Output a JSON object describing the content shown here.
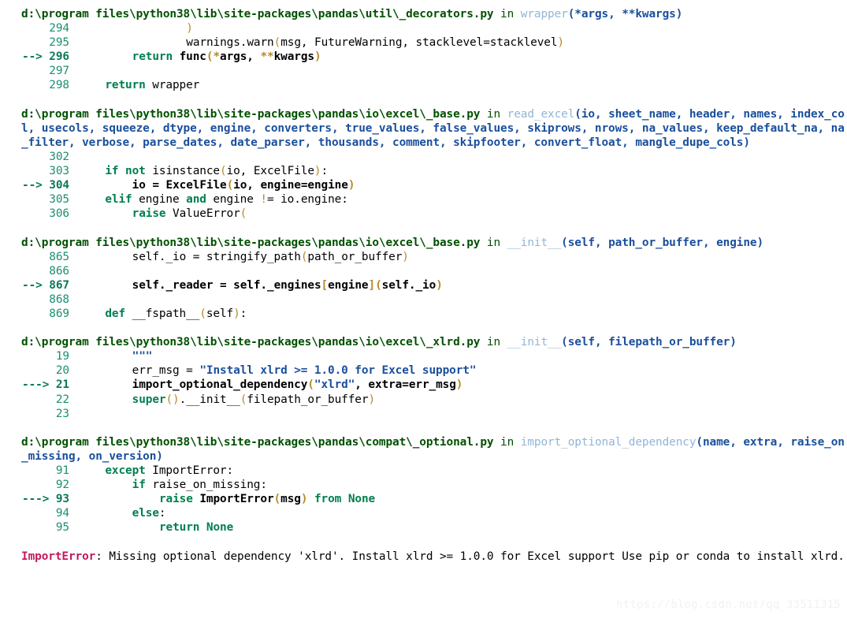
{
  "colors": {
    "background": "#ffffff",
    "filepath": "#005000",
    "function_name": "#92b5d6",
    "signature": "#1a4f9c",
    "line_number": "#1a8f72",
    "keyword": "#007f4f",
    "punctuation": "#b58b2a",
    "string": "#1a4f9c",
    "error_type": "#c2185b",
    "code": "#000000",
    "watermark": "#f2f2f2"
  },
  "traceback": {
    "frames": [
      {
        "id": "frame-decorators",
        "path": "d:\\program files\\python38\\lib\\site-packages\\pandas\\util\\_decorators.py",
        "in_kw": " in ",
        "func": "wrapper",
        "signature": "(*args, **kwargs)",
        "lines": [
          {
            "num": "294",
            "arrow": "",
            "current": false,
            "code": "                )"
          },
          {
            "num": "295",
            "arrow": "",
            "current": false,
            "code": "                warnings.warn(msg, FutureWarning, stacklevel=stacklevel)"
          },
          {
            "num": "296",
            "arrow": "-->",
            "current": true,
            "code": "        return func(*args, **kwargs)"
          },
          {
            "num": "297",
            "arrow": "",
            "current": false,
            "code": ""
          },
          {
            "num": "298",
            "arrow": "",
            "current": false,
            "code": "    return wrapper"
          }
        ]
      },
      {
        "id": "frame-excel-base-read",
        "path": "d:\\program files\\python38\\lib\\site-packages\\pandas\\io\\excel\\_base.py",
        "in_kw": " in ",
        "func": "read_excel",
        "signature": "(io, sheet_name, header, names, index_col, usecols, squeeze, dtype, engine, converters, true_values, false_values, skiprows, nrows, na_values, keep_default_na, na_filter, verbose, parse_dates, date_parser, thousands, comment, skipfooter, convert_float, mangle_dupe_cols)",
        "lines": [
          {
            "num": "302",
            "arrow": "",
            "current": false,
            "code": ""
          },
          {
            "num": "303",
            "arrow": "",
            "current": false,
            "code": "    if not isinstance(io, ExcelFile):"
          },
          {
            "num": "304",
            "arrow": "-->",
            "current": true,
            "code": "        io = ExcelFile(io, engine=engine)"
          },
          {
            "num": "305",
            "arrow": "",
            "current": false,
            "code": "    elif engine and engine != io.engine:"
          },
          {
            "num": "306",
            "arrow": "",
            "current": false,
            "code": "        raise ValueError("
          }
        ]
      },
      {
        "id": "frame-excel-base-init",
        "path": "d:\\program files\\python38\\lib\\site-packages\\pandas\\io\\excel\\_base.py",
        "in_kw": " in ",
        "func": "__init__",
        "signature": "(self, path_or_buffer, engine)",
        "lines": [
          {
            "num": "865",
            "arrow": "",
            "current": false,
            "code": "        self._io = stringify_path(path_or_buffer)"
          },
          {
            "num": "866",
            "arrow": "",
            "current": false,
            "code": ""
          },
          {
            "num": "867",
            "arrow": "-->",
            "current": true,
            "code": "        self._reader = self._engines[engine](self._io)"
          },
          {
            "num": "868",
            "arrow": "",
            "current": false,
            "code": ""
          },
          {
            "num": "869",
            "arrow": "",
            "current": false,
            "code": "    def __fspath__(self):"
          }
        ]
      },
      {
        "id": "frame-excel-xlrd-init",
        "path": "d:\\program files\\python38\\lib\\site-packages\\pandas\\io\\excel\\_xlrd.py",
        "in_kw": " in ",
        "func": "__init__",
        "signature": "(self, filepath_or_buffer)",
        "lines": [
          {
            "num": "19",
            "arrow": "",
            "current": false,
            "code": "        \"\"\""
          },
          {
            "num": "20",
            "arrow": "",
            "current": false,
            "code": "        err_msg = \"Install xlrd >= 1.0.0 for Excel support\""
          },
          {
            "num": "21",
            "arrow": "--->",
            "current": true,
            "code": "        import_optional_dependency(\"xlrd\", extra=err_msg)"
          },
          {
            "num": "22",
            "arrow": "",
            "current": false,
            "code": "        super().__init__(filepath_or_buffer)"
          },
          {
            "num": "23",
            "arrow": "",
            "current": false,
            "code": ""
          }
        ]
      },
      {
        "id": "frame-compat-optional",
        "path": "d:\\program files\\python38\\lib\\site-packages\\pandas\\compat\\_optional.py",
        "in_kw": " in ",
        "func": "import_optional_dependency",
        "signature": "(name, extra, raise_on_missing, on_version)",
        "lines": [
          {
            "num": "91",
            "arrow": "",
            "current": false,
            "code": "    except ImportError:"
          },
          {
            "num": "92",
            "arrow": "",
            "current": false,
            "code": "        if raise_on_missing:"
          },
          {
            "num": "93",
            "arrow": "--->",
            "current": true,
            "code": "            raise ImportError(msg) from None"
          },
          {
            "num": "94",
            "arrow": "",
            "current": false,
            "code": "        else:"
          },
          {
            "num": "95",
            "arrow": "",
            "current": false,
            "code": "            return None"
          }
        ]
      }
    ],
    "error": {
      "type": "ImportError",
      "separator": ": ",
      "message": "Missing optional dependency 'xlrd'. Install xlrd >= 1.0.0 for Excel support Use pip or conda to install xlrd."
    }
  },
  "watermark": {
    "text": "https://blog.csdn.net/qq_33511315"
  }
}
